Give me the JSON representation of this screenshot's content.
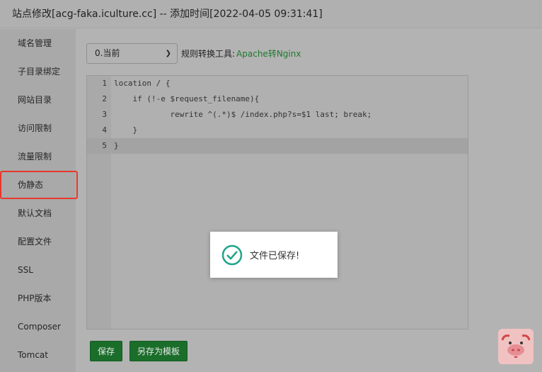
{
  "window": {
    "title": "站点修改[acg-faka.iculture.cc] -- 添加时间[2022-04-05 09:31:41]"
  },
  "sidebar": {
    "items": [
      {
        "label": "域名管理"
      },
      {
        "label": "子目录绑定"
      },
      {
        "label": "网站目录"
      },
      {
        "label": "访问限制"
      },
      {
        "label": "流量限制"
      },
      {
        "label": "伪静态",
        "active": true
      },
      {
        "label": "默认文档"
      },
      {
        "label": "配置文件"
      },
      {
        "label": "SSL"
      },
      {
        "label": "PHP版本"
      },
      {
        "label": "Composer"
      },
      {
        "label": "Tomcat"
      }
    ]
  },
  "toolbar": {
    "version_select": "0.当前",
    "tool_label": "规则转换工具:",
    "tool_link": "Apache转Nginx"
  },
  "editor": {
    "lines": [
      {
        "n": "1",
        "code": "location / {"
      },
      {
        "n": "2",
        "code": "    if (!-e $request_filename){"
      },
      {
        "n": "3",
        "code": "            rewrite ^(.*)$ /index.php?s=$1 last; break;"
      },
      {
        "n": "4",
        "code": "    }"
      },
      {
        "n": "5",
        "code": "}"
      }
    ],
    "active_line": 5
  },
  "toast": {
    "message": "文件已保存!",
    "icon": "check-circle-icon"
  },
  "buttons": {
    "save": "保存",
    "save_template": "另存为模板"
  },
  "colors": {
    "accent": "#20a53a",
    "active_border": "#e8392c"
  }
}
